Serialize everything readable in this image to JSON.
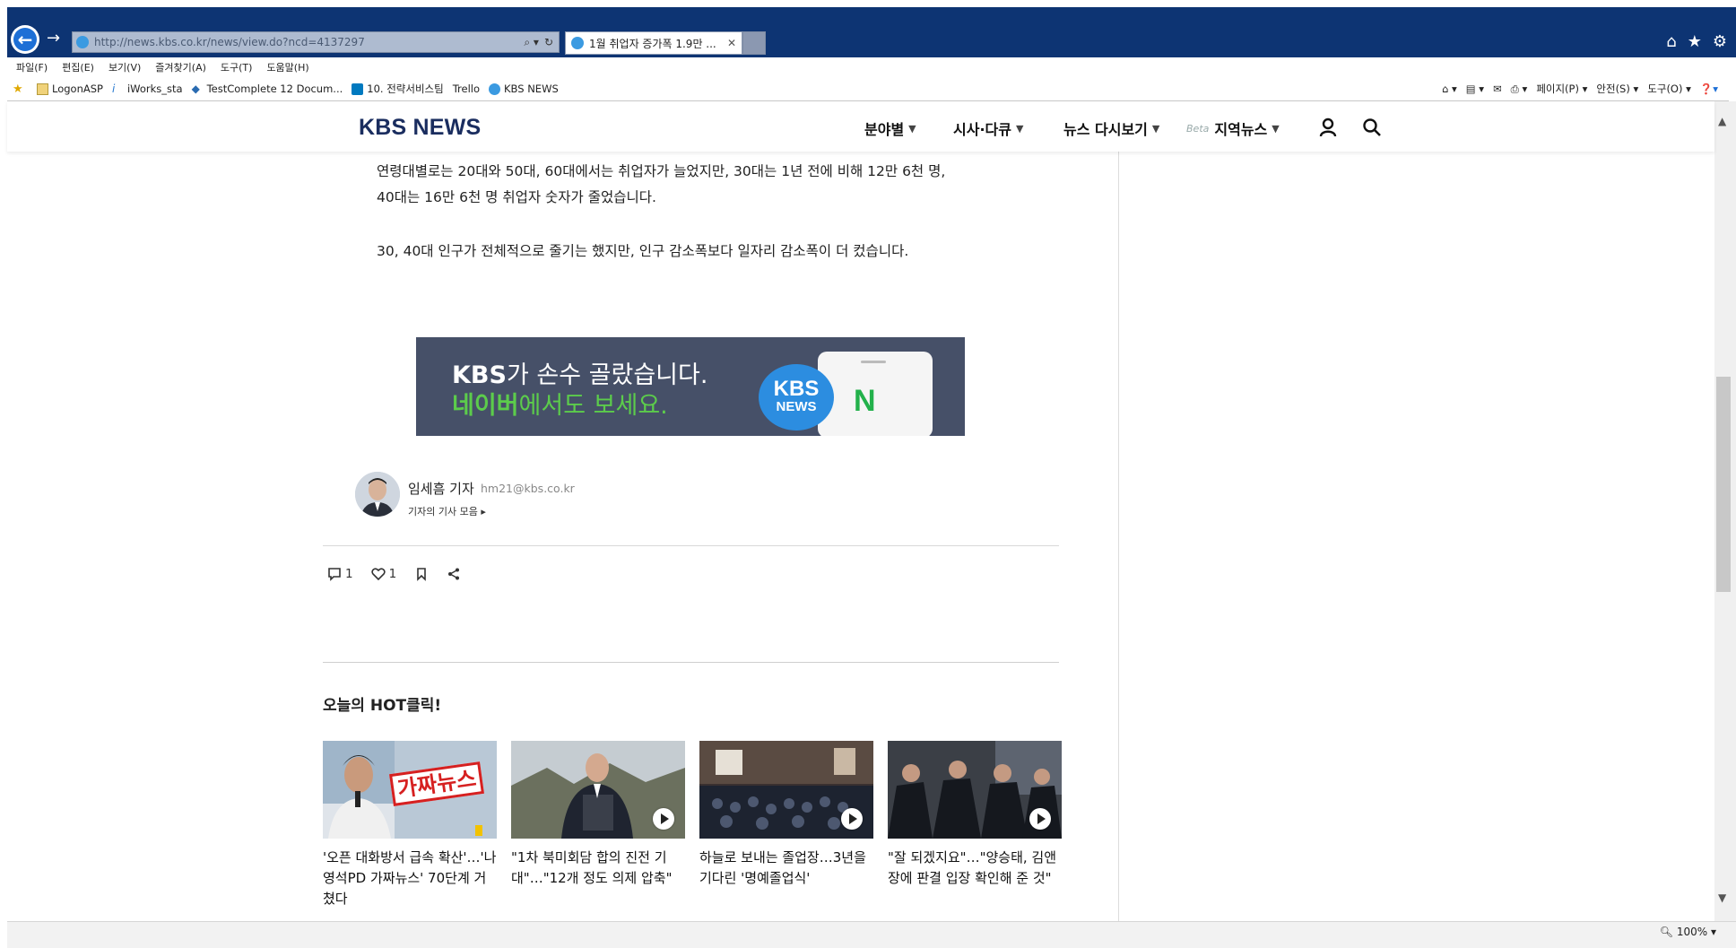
{
  "browser": {
    "url": "http://news.kbs.co.kr/news/view.do?ncd=4137297",
    "tab_title": "1월 취업자 증가폭 1.9만 ...",
    "tab_close": "✕",
    "menu": [
      "파일(F)",
      "편집(E)",
      "보기(V)",
      "즐겨찾기(A)",
      "도구(T)",
      "도움말(H)"
    ],
    "favorites": [
      "LogonASP",
      "iWorks_sta",
      "TestComplete 12 Docum...",
      "10. 전략서비스팀",
      "Trello",
      "KBS NEWS"
    ],
    "commands": [
      "페이지(P)",
      "안전(S)",
      "도구(O)"
    ],
    "zoom": "100%"
  },
  "site": {
    "logo": "KBS NEWS",
    "nav": [
      "분야별",
      "시사·다큐",
      "뉴스 다시보기",
      "지역뉴스"
    ],
    "beta": "Beta"
  },
  "article": {
    "paragraphs": [
      "연령대별로는 20대와 50대, 60대에서는 취업자가 늘었지만, 30대는 1년 전에 비해 12만 6천 명,",
      "40대는 16만 6천 명 취업자 숫자가 줄었습니다.",
      "30, 40대 인구가 전체적으로 줄기는 했지만, 인구 감소폭보다 일자리 감소폭이 더 컸습니다."
    ],
    "ad": {
      "line1_bold": "KBS",
      "line1_rest": "가 손수 골랐습니다.",
      "line2_bold": "네이버",
      "line2_rest": "에서도 보세요.",
      "bubble_top": "KBS",
      "bubble_bottom": "NEWS",
      "naver_letter": "N"
    },
    "reporter": {
      "name": "임세흠 기자",
      "email": "hm21@kbs.co.kr",
      "more_link": "기자의 기사 모음 ▸"
    },
    "actions": {
      "comments": "1",
      "likes": "1"
    }
  },
  "hot": {
    "title": "오늘의 HOT클릭!",
    "cards": [
      {
        "caption": "'오픈 대화방서 급속 확산'…'나영석PD 가짜뉴스' 70단계 거쳤다",
        "thumb_text": "가짜뉴스",
        "has_play": false
      },
      {
        "caption": "\"1차 북미회담 합의 진전 기대\"…\"12개 정도 의제 압축\"",
        "has_play": true
      },
      {
        "caption": "하늘로 보내는 졸업장…3년을 기다린 '명예졸업식'",
        "has_play": true
      },
      {
        "caption": "\"잘 되겠지요\"…\"양승태, 김앤장에 판결 입장 확인해 준 것\"",
        "has_play": true
      }
    ]
  },
  "colors": {
    "browser_frame": "#0d3473",
    "logo": "#1a2d5f",
    "ad_bg": "#465068",
    "naver_green": "#5ccc4b",
    "kbs_blue": "#2c8de0"
  }
}
